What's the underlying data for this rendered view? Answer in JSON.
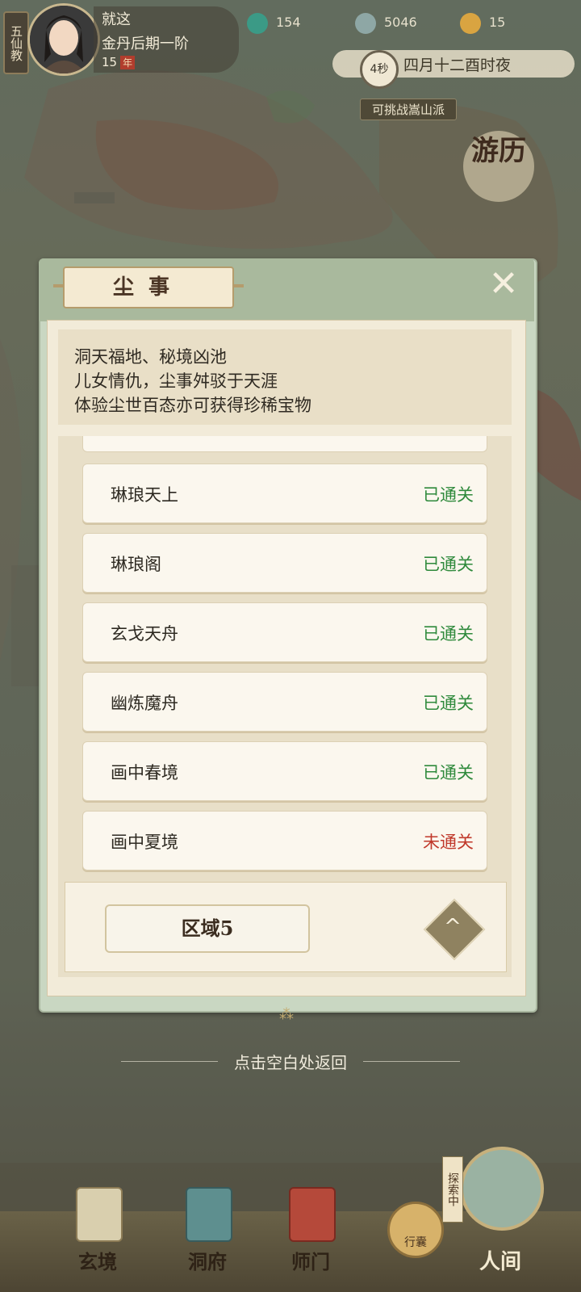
{
  "header": {
    "sect": "五仙教",
    "player_name": "就这",
    "player_rank": "金丹后期一阶",
    "player_age": "15",
    "age_unit": "年",
    "resources": [
      {
        "icon": "jade-icon",
        "value": "154",
        "color": "#3b9a86"
      },
      {
        "icon": "coin-icon",
        "value": "5046",
        "color": "#8ea7a5"
      },
      {
        "icon": "ingot-icon",
        "value": "15",
        "color": "#d9a441"
      }
    ],
    "timer": "4秒",
    "game_time": "四月十二酉时夜",
    "challenge": "可挑战嵩山派",
    "youli": "游历"
  },
  "modal": {
    "title": "尘事",
    "close_icon": "close-icon",
    "description": [
      "洞天福地、秘境凶池",
      "儿女情仇，尘事舛驳于天涯",
      "体验尘世百态亦可获得珍稀宝物"
    ],
    "items": [
      {
        "label": "琳琅天上",
        "status": "已通关",
        "done": true
      },
      {
        "label": "琳琅阁",
        "status": "已通关",
        "done": true
      },
      {
        "label": "玄戈天舟",
        "status": "已通关",
        "done": true
      },
      {
        "label": "幽炼魔舟",
        "status": "已通关",
        "done": true
      },
      {
        "label": "画中春境",
        "status": "已通关",
        "done": true
      },
      {
        "label": "画中夏境",
        "status": "未通关",
        "done": false
      }
    ],
    "region": "区域5",
    "collapse_icon": "chevron-up-icon",
    "colors": {
      "done": "#2f8a3c",
      "todo": "#c0392b"
    }
  },
  "hint": "点击空白处返回",
  "nav": {
    "items": [
      {
        "label": "玄境",
        "icon": "scroll-icon"
      },
      {
        "label": "洞府",
        "icon": "pavilion-icon"
      },
      {
        "label": "师门",
        "icon": "banner-icon"
      }
    ],
    "bag": "行囊",
    "explore": "探索中",
    "renjian": "人间"
  }
}
